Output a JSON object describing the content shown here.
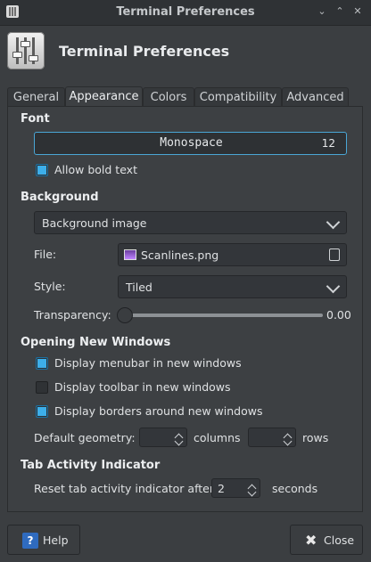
{
  "window": {
    "title": "Terminal Preferences"
  },
  "header": {
    "title": "Terminal Preferences"
  },
  "tabs": [
    {
      "label": "General"
    },
    {
      "label": "Appearance"
    },
    {
      "label": "Colors"
    },
    {
      "label": "Compatibility"
    },
    {
      "label": "Advanced"
    }
  ],
  "active_tab": "Appearance",
  "font": {
    "section": "Font",
    "name": "Monospace",
    "size": "12",
    "allow_bold_label": "Allow bold text",
    "allow_bold": true
  },
  "background": {
    "section": "Background",
    "mode": "Background image",
    "file_label": "File:",
    "file": "Scanlines.png",
    "style_label": "Style:",
    "style": "Tiled",
    "transparency_label": "Transparency:",
    "transparency": "0.00"
  },
  "new_windows": {
    "section": "Opening New Windows",
    "options": [
      {
        "label": "Display menubar in new windows",
        "checked": true
      },
      {
        "label": "Display toolbar in new windows",
        "checked": false
      },
      {
        "label": "Display borders around new windows",
        "checked": true
      }
    ],
    "geometry_label": "Default geometry:",
    "columns_value": "",
    "columns_label": "columns",
    "rows_value": "",
    "rows_label": "rows"
  },
  "tab_activity": {
    "section": "Tab Activity Indicator",
    "reset_label": "Reset tab activity indicator after",
    "reset_value": "2",
    "seconds_label": "seconds"
  },
  "buttons": {
    "help": "Help",
    "close": "Close"
  },
  "colors": {
    "accent": "#3daee9",
    "background": "#3d4043"
  }
}
